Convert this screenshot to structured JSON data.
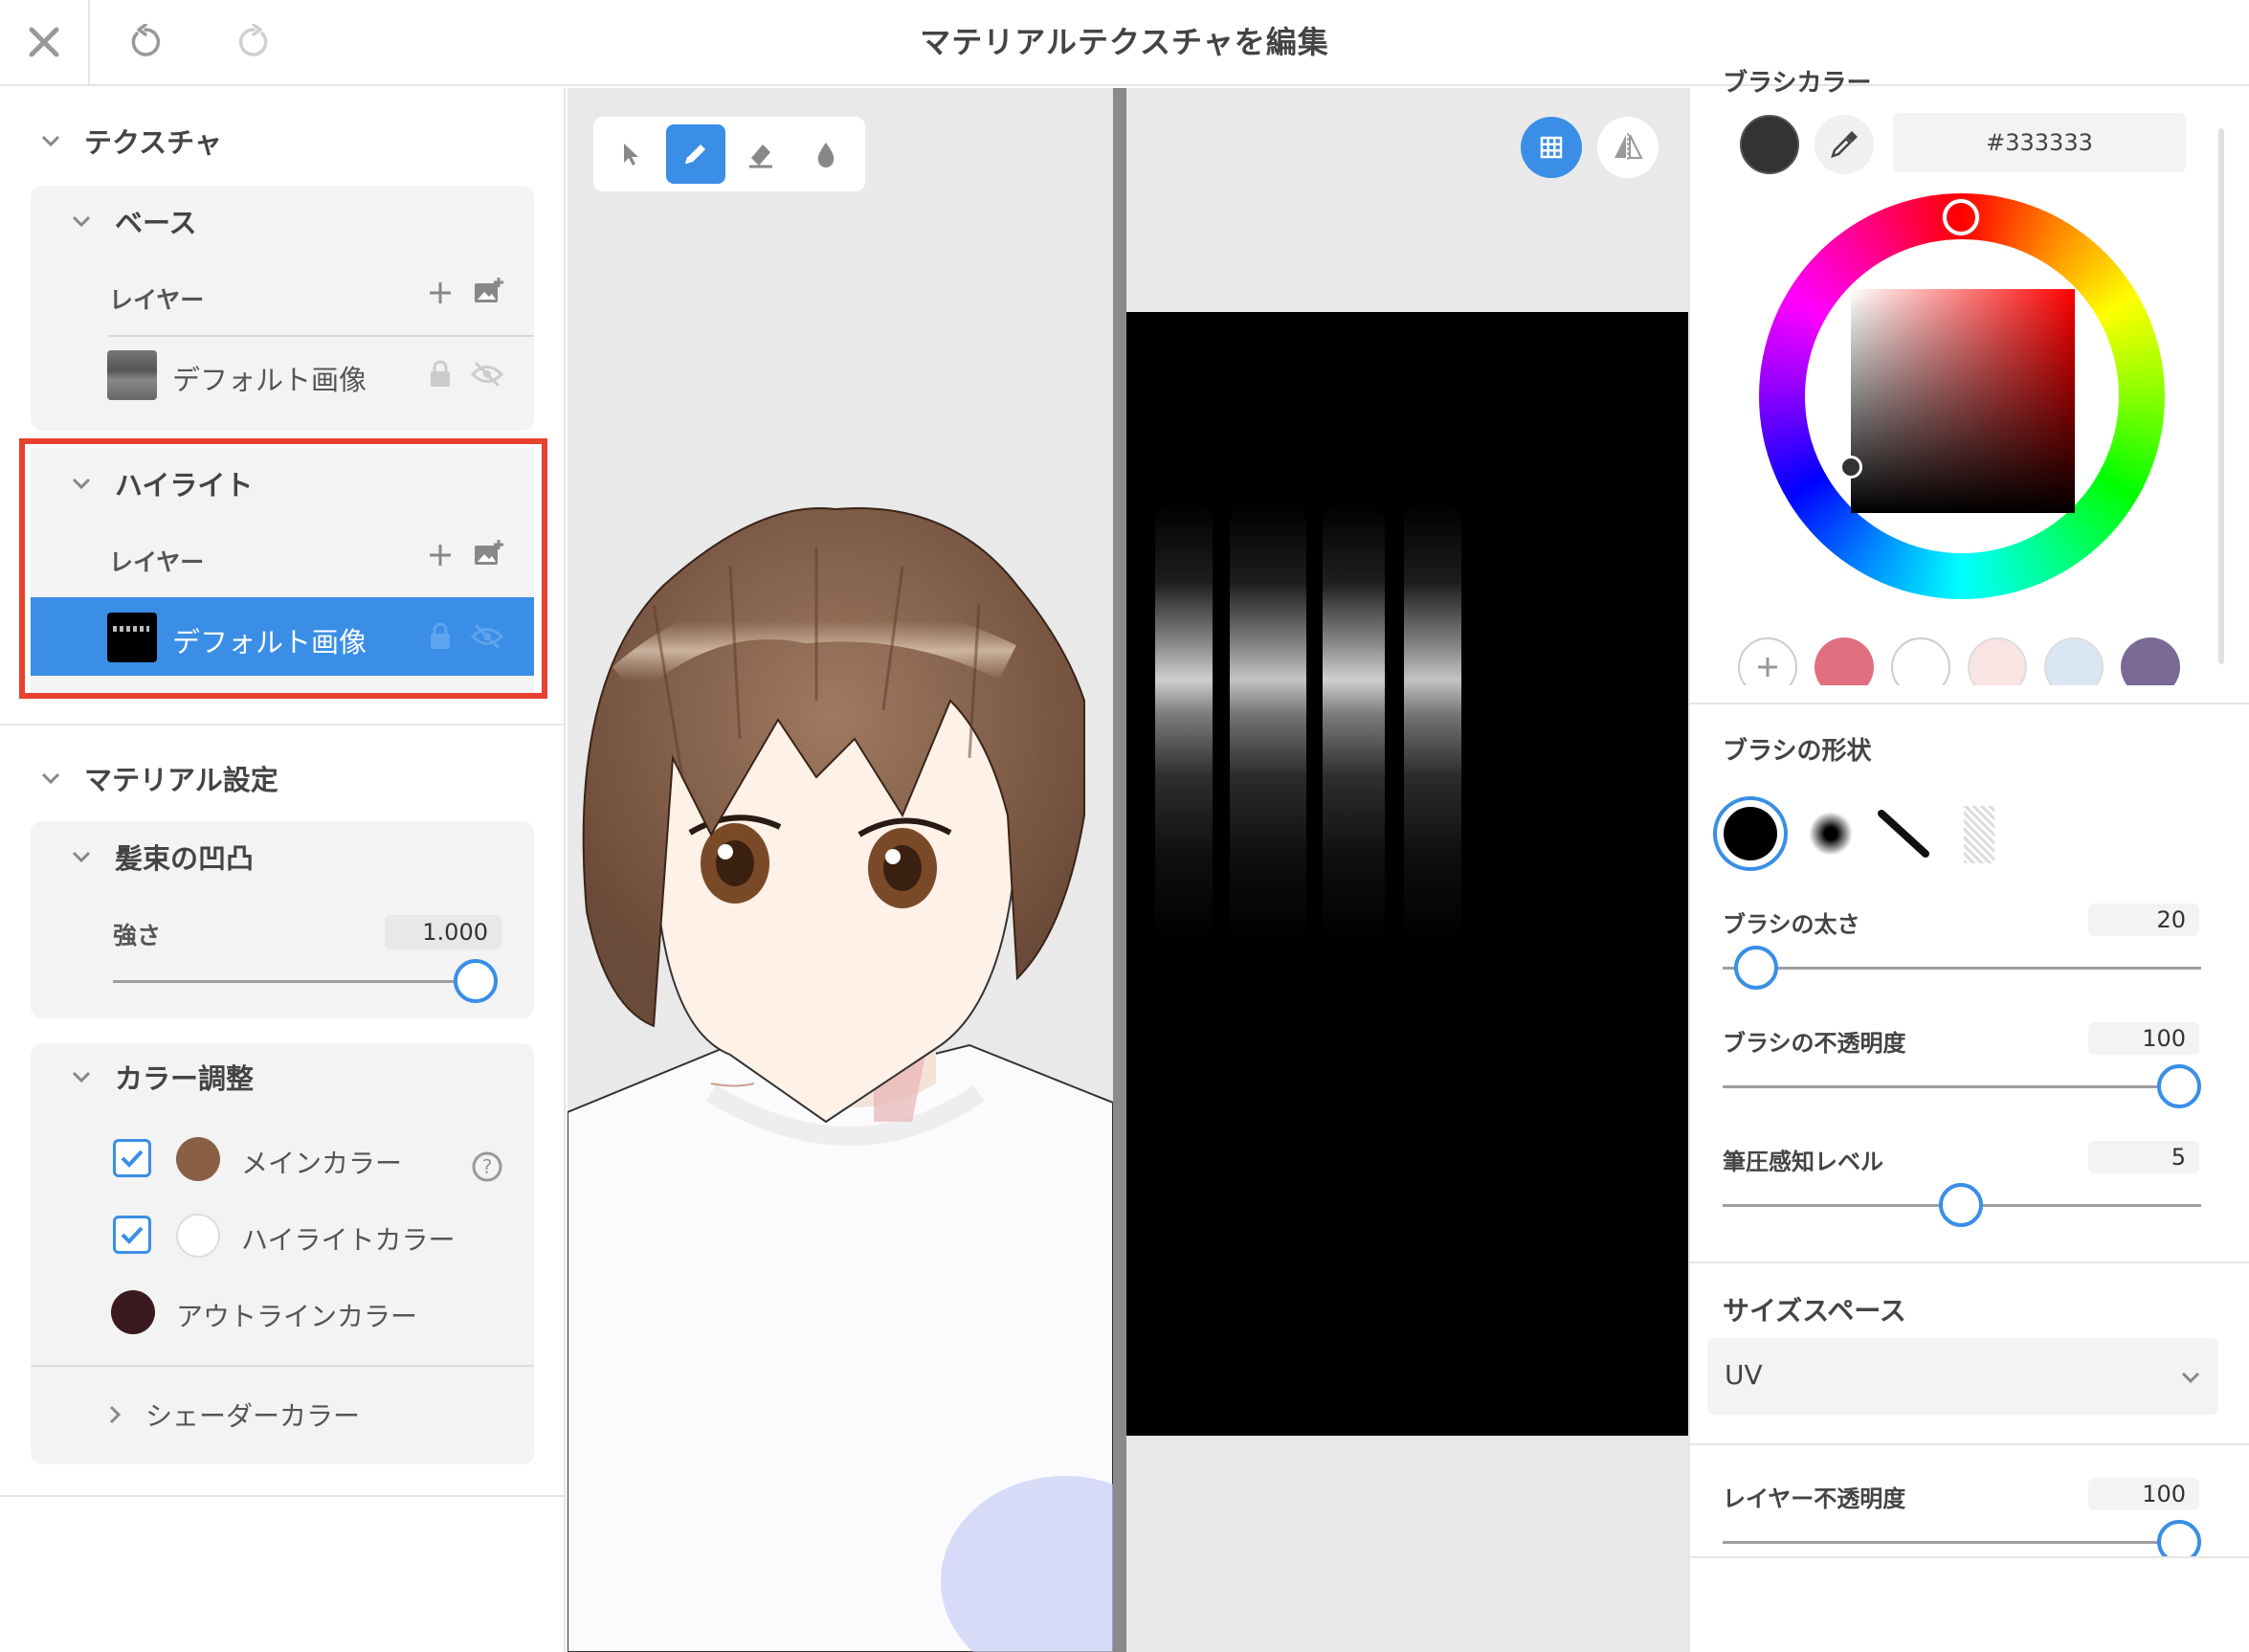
{
  "app": {
    "title": "マテリアルテクスチャを編集"
  },
  "topbar": {
    "close_icon": "close-icon",
    "undo_icon": "undo-icon",
    "redo_icon": "redo-icon"
  },
  "left": {
    "texture_header": "テクスチャ",
    "base": {
      "title": "ベース",
      "layer_label": "レイヤー",
      "layer_name": "デフォルト画像"
    },
    "highlight": {
      "title": "ハイライト",
      "layer_label": "レイヤー",
      "layer_name": "デフォルト画像"
    },
    "material_header": "マテリアル設定",
    "bump": {
      "title": "髪束の凹凸",
      "strength_label": "強さ",
      "strength_value": "1.000",
      "strength_fraction": 1.0
    },
    "color_adjust": {
      "title": "カラー調整",
      "items": [
        {
          "label": "メインカラー",
          "checked": true,
          "color": "#8a6045"
        },
        {
          "label": "ハイライトカラー",
          "checked": true,
          "color": "#ffffff"
        },
        {
          "label": "アウトラインカラー",
          "color": "#3a1a20"
        }
      ],
      "shader_color": "シェーダーカラー"
    }
  },
  "colors": {
    "accent": "#3a8ee6",
    "highlight_border": "#e8412e"
  },
  "right": {
    "brush_color_label": "ブラシカラー",
    "hex_value": "#333333",
    "current_color": "#333333",
    "palette": [
      "#e07080",
      "#ffffff",
      "#f8e4e2",
      "#dbe6f4",
      "#7a6a96"
    ],
    "brush_shape_label": "ブラシの形状",
    "brush_size": {
      "label": "ブラシの太さ",
      "value": "20",
      "fraction": 0.1
    },
    "brush_opacity": {
      "label": "ブラシの不透明度",
      "value": "100",
      "fraction": 1.0
    },
    "pressure": {
      "label": "筆圧感知レベル",
      "value": "5",
      "fraction": 0.5
    },
    "size_space": {
      "label": "サイズスペース",
      "value": "UV"
    },
    "layer_opacity": {
      "label": "レイヤー不透明度",
      "value": "100",
      "fraction": 1.0
    }
  }
}
